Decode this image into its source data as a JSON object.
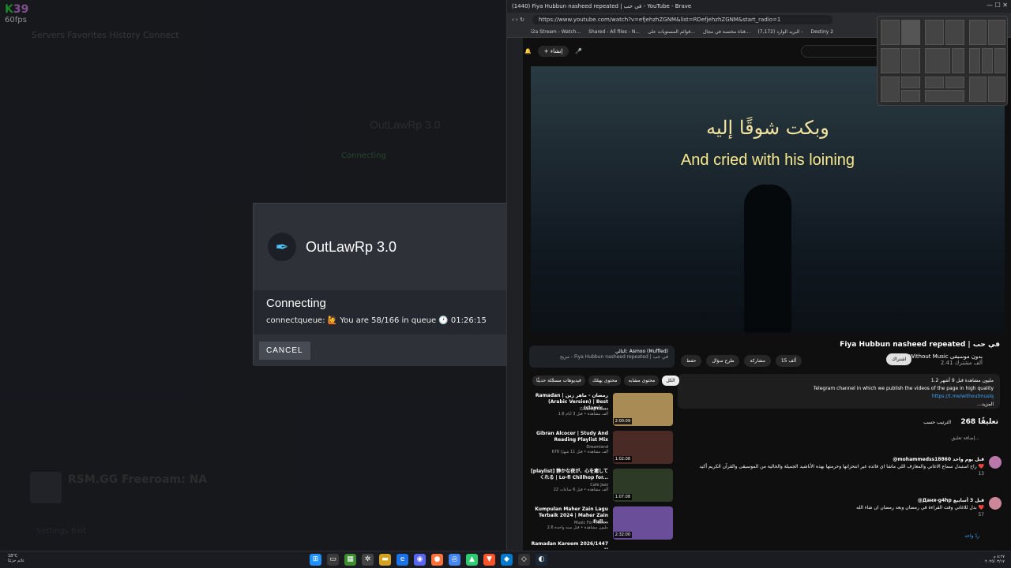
{
  "overlay": {
    "fps_k": "K",
    "fps_num": "39",
    "fps_label": "60fps"
  },
  "game": {
    "tabs": "Servers   Favorites   History   Connect",
    "server_title": "OutLawRp 3.0",
    "server_sub": "Connecting",
    "server2_name": "RSM.GG Freeroam: NA",
    "bottom": "Settings   Exit"
  },
  "modal": {
    "title": "OutLawRp 3.0",
    "status": "Connecting",
    "queue": "connectqueue: 🙋 You are 58/166 in queue 🕐 01:26:15",
    "cancel": "CANCEL"
  },
  "browser": {
    "window_title": "(1440) Fiya Hubbun nasheed repeated | في حب - YouTube - Brave",
    "url": "https://www.youtube.com/watch?v=efjehzhZGNM&list=RDefjehzhZGNM&start_radio=1",
    "bookmarks": [
      "i2a Stream - Watch...",
      "Shared - All files - N...",
      "قوائم المستويات على...",
      "قناة مختصة في مجال...",
      "البريد الوارد (7,172) -",
      "Destiny 2"
    ],
    "create": "إنشاء"
  },
  "video": {
    "arabic_text": "وبكت شوقًا إليه",
    "subtitle": "And cried with his loining",
    "title": "Fiya Hubbun nasheed repeated | في حب",
    "channel": "Without Music بدون موسيقى",
    "subs": "2.41 ألف مشترك",
    "subscribe": "اشتراك",
    "like": "15 ألف",
    "share": "مشاركة",
    "ask": "طرح سؤال",
    "save": "حفظ",
    "desc_line1": "1.2 مليون مشاهدة قبل 9 أشهر",
    "desc_line2": "Telegram channel in which we publish the videos of the page in high quality",
    "desc_link": "https://t.me/withoutmusiq",
    "desc_more": "...المزيد",
    "playlist_next": "التالي: Asmoo (Muffled)",
    "playlist_name": "مزيج - Fiya Hubbun nasheed repeated | في حب"
  },
  "chips": [
    "الكل",
    "محتوى مشابه",
    "محتوى يهمّك",
    "فيديوهات مسجّلة حديثًا"
  ],
  "recs": [
    {
      "title": "Ramadan | رمضان - ماهر زين (Arabic Version) | Best Islamic...",
      "channel": "Glowing Tunes",
      "meta": "1.6 ألف مشاهدة • قبل 3 أيام",
      "dur": "2:00:09"
    },
    {
      "title": "Gibran Alcocer | Study And Reading Playlist Mix",
      "channel": "Dreamland",
      "meta": "676 ألف مشاهدة • قبل 11 شهرًا",
      "dur": "1:02:08"
    },
    {
      "title": "[playlist] 静かな夜が、心を癒してくれる | Lo-fi Chillhop for...",
      "channel": "Cafe Jazz",
      "meta": "22 ألف مشاهدة • قبل 6 ساعات",
      "dur": "1:07:08"
    },
    {
      "title": "Kumpulan Maher Zain Lagu Terbaik 2024 | Maher Zain Full...",
      "channel": "Music For Muslim",
      "meta": "2.6 مليون مشاهدة • قبل سنة واحدة",
      "dur": "2:32:00"
    },
    {
      "title": "Ramadan Kareem 2026/1447 H",
      "channel": "",
      "meta": "",
      "dur": ""
    }
  ],
  "comments": {
    "count": "268 تعليقًا",
    "sort": "الترتيب حسب",
    "add": "إضافة تعليق...",
    "items": [
      {
        "user": "@mohammedss18860 قبل يوم واحد",
        "text": "راح استبدل سماع الاغاني والمعازف اللي ماشا اي فائده غير انتحزانها وحرمتها بهذه الأناشيد الجميلة والخالية من الموسيقى والقرآن الكريم أكيد ❤️",
        "likes": "13"
      },
      {
        "user": "@Даня-g4hp قبل 3 أسابيع",
        "text": "بدل للاغاني وقت القراءة في رمضان وبعد رمضان ان شاء الله ❤️",
        "likes": "57"
      }
    ],
    "replies": "ردّ واحد"
  },
  "taskbar": {
    "temp": "18°C",
    "weather": "غائم جزئيًا",
    "time": "٨:٢٧ م",
    "date": "٢٠٢٥/٠٣/١٧"
  }
}
